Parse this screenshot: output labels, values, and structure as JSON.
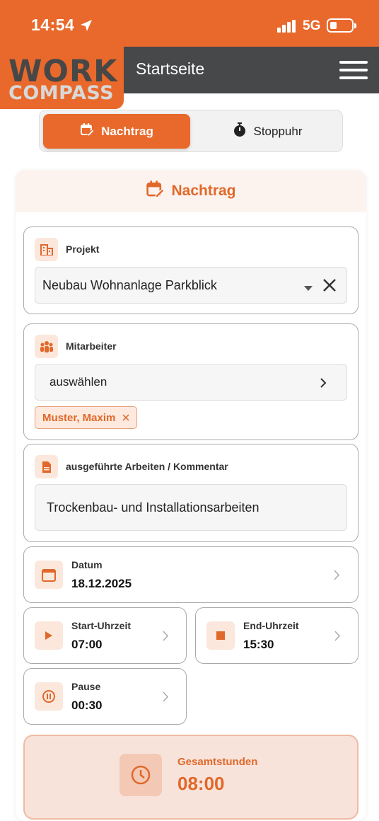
{
  "status_bar": {
    "time": "14:54",
    "network": "5G"
  },
  "logo": {
    "line1": "WORK",
    "line2": "COMPASS"
  },
  "header": {
    "title": "Startseite"
  },
  "tabs": [
    {
      "label": "Nachtrag"
    },
    {
      "label": "Stoppuhr"
    }
  ],
  "form": {
    "title": "Nachtrag",
    "project": {
      "label": "Projekt",
      "value": "Neubau Wohnanlage Parkblick"
    },
    "employees": {
      "label": "Mitarbeiter",
      "select_text": "auswählen",
      "chips": [
        "Muster, Maxim"
      ]
    },
    "work": {
      "label": "ausgeführte Arbeiten / Kommentar",
      "value": "Trockenbau- und Installationsarbeiten"
    },
    "date": {
      "label": "Datum",
      "value": "18.12.2025"
    },
    "start": {
      "label": "Start-Uhrzeit",
      "value": "07:00"
    },
    "end": {
      "label": "End-Uhrzeit",
      "value": "15:30"
    },
    "pause": {
      "label": "Pause",
      "value": "00:30"
    },
    "total": {
      "label": "Gesamtstunden",
      "value": "08:00"
    }
  },
  "colors": {
    "accent": "#e8692b",
    "header": "#464849"
  }
}
